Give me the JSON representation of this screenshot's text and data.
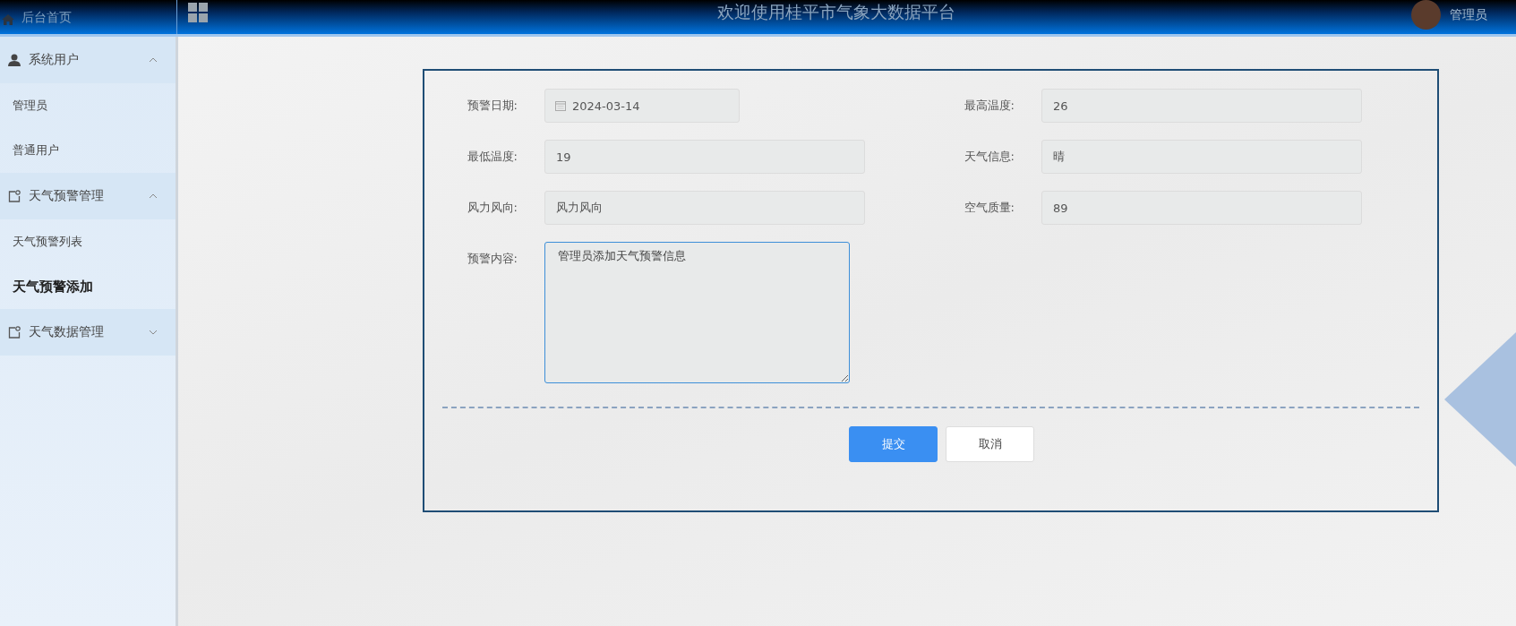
{
  "header": {
    "home_label": "后台首页",
    "title": "欢迎使用桂平市气象大数据平台",
    "user_name": "管理员"
  },
  "sidebar": {
    "groups": [
      {
        "label": "系统用户",
        "kind": "user",
        "expanded": true,
        "items": [
          {
            "label": "管理员",
            "selected": false
          },
          {
            "label": "普通用户",
            "selected": false
          }
        ]
      },
      {
        "label": "天气预警管理",
        "kind": "module",
        "expanded": true,
        "items": [
          {
            "label": "天气预警列表",
            "selected": false
          },
          {
            "label": "天气预警添加",
            "selected": true
          }
        ]
      },
      {
        "label": "天气数据管理",
        "kind": "module",
        "expanded": false
      }
    ]
  },
  "form": {
    "fields": [
      {
        "label": "预警日期:",
        "kind": "date",
        "value": "2024-03-14"
      },
      {
        "label": "最高温度:",
        "kind": "text",
        "value": "26"
      },
      {
        "label": "最低温度:",
        "kind": "text",
        "value": "19"
      },
      {
        "label": "天气信息:",
        "kind": "text",
        "value": "晴"
      },
      {
        "label": "风力风向:",
        "kind": "text",
        "value": "风力风向"
      },
      {
        "label": "空气质量:",
        "kind": "text",
        "value": "89"
      },
      {
        "label": "预警内容:",
        "kind": "textarea",
        "value": "管理员添加天气预警信息"
      }
    ],
    "buttons": [
      {
        "label": "提交",
        "kind": "primary"
      },
      {
        "label": "取消",
        "kind": "default"
      }
    ]
  }
}
